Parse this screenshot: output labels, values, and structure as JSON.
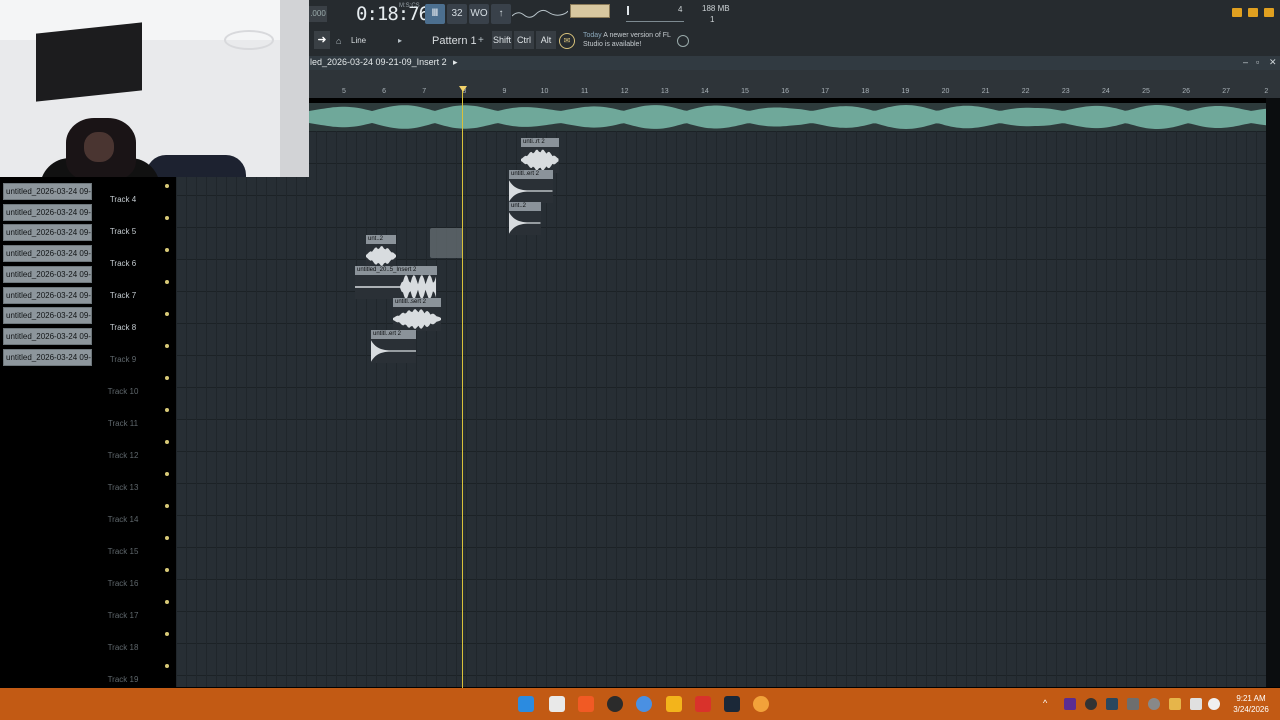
{
  "transport": {
    "tempo_partial": ".000",
    "time": "0:18:76",
    "time_unit": "M:S:CS",
    "buttons": [
      "Ⅲ",
      "32",
      "WO",
      "↑"
    ],
    "cpu_mem": "188 MB",
    "cpu_num": "4",
    "voices": "1"
  },
  "toolbar2": {
    "snap_label": "Line",
    "pattern_label": "Pattern 1",
    "pattern_plus": "+",
    "mods": [
      "Shift",
      "Ctrl",
      "Alt"
    ],
    "notice_prefix": "Today",
    "notice_text": "A newer version of FL Studio is available!"
  },
  "playlist": {
    "title": "led_2026-03-24 09-21-09_Insert 2",
    "title_arrow": "▸"
  },
  "ruler": {
    "bars": [
      "5",
      "6",
      "7",
      "8",
      "9",
      "10",
      "11",
      "12",
      "13",
      "14",
      "15",
      "16",
      "17",
      "18",
      "19",
      "20",
      "21",
      "22",
      "23",
      "24",
      "25",
      "26",
      "27",
      "2"
    ]
  },
  "picker": {
    "items": [
      "untitled_2026-03-24 09-...",
      "untitled_2026-03-24 09-...",
      "untitled_2026-03-24 09-...",
      "untitled_2026-03-24 09-...",
      "untitled_2026-03-24 09-...",
      "untitled_2026-03-24 09-...",
      "untitled_2026-03-24 09-...",
      "untitled_2026-03-24 09-...",
      "untitled_2026-03-24 09-..."
    ]
  },
  "tracks": [
    {
      "label": "Track 4",
      "dim": false
    },
    {
      "label": "Track 5",
      "dim": false
    },
    {
      "label": "Track 6",
      "dim": false
    },
    {
      "label": "Track 7",
      "dim": false
    },
    {
      "label": "Track 8",
      "dim": false
    },
    {
      "label": "Track 9",
      "dim": true
    },
    {
      "label": "Track 10",
      "dim": true
    },
    {
      "label": "Track 11",
      "dim": true
    },
    {
      "label": "Track 12",
      "dim": true
    },
    {
      "label": "Track 13",
      "dim": true
    },
    {
      "label": "Track 14",
      "dim": true
    },
    {
      "label": "Track 15",
      "dim": true
    },
    {
      "label": "Track 16",
      "dim": true
    },
    {
      "label": "Track 17",
      "dim": true
    },
    {
      "label": "Track 18",
      "dim": true
    },
    {
      "label": "Track 19",
      "dim": true
    }
  ],
  "clips": [
    {
      "name": "unti..rt 2"
    },
    {
      "name": "untitl..ert 2"
    },
    {
      "name": "unt..2"
    },
    {
      "name": "unt..2"
    },
    {
      "name": "untitled_20..5_Insert 2"
    },
    {
      "name": "untitl..sert 2"
    },
    {
      "name": "untitl..ert 2"
    }
  ],
  "taskbar": {
    "time": "9:21 AM",
    "date": "3/24/2026"
  },
  "colors": {
    "accent": "#d9c13a",
    "taskbar": "#c25a14",
    "overview_wave": "#6fa89a",
    "clip_header": "#8b939a"
  }
}
